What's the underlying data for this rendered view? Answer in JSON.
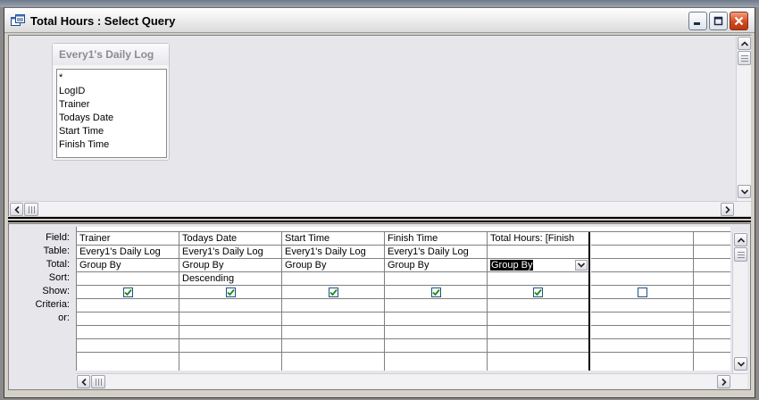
{
  "window": {
    "title": "Total Hours : Select Query",
    "icon": "query-icon",
    "controls": [
      "minimize-icon",
      "maximize-icon",
      "close-icon"
    ]
  },
  "field_list": {
    "title": "Every1's Daily Log",
    "items": [
      "*",
      "LogID",
      "Trainer",
      "Todays Date",
      "Start Time",
      "Finish Time"
    ]
  },
  "grid": {
    "row_labels": [
      "Field:",
      "Table:",
      "Total:",
      "Sort:",
      "Show:",
      "Criteria:",
      "or:"
    ],
    "columns": [
      {
        "field": "Trainer",
        "table": "Every1's Daily Log",
        "total": "Group By",
        "sort": "",
        "show": true
      },
      {
        "field": "Todays Date",
        "table": "Every1's Daily Log",
        "total": "Group By",
        "sort": "Descending",
        "show": true
      },
      {
        "field": "Start Time",
        "table": "Every1's Daily Log",
        "total": "Group By",
        "sort": "",
        "show": true
      },
      {
        "field": "Finish Time",
        "table": "Every1's Daily Log",
        "total": "Group By",
        "sort": "",
        "show": true
      },
      {
        "field": "Total Hours: [Finish",
        "table": "",
        "total": "Group By",
        "sort": "",
        "show": true
      },
      {
        "field": "",
        "table": "",
        "total": "",
        "sort": "",
        "show": false
      },
      {
        "field": "",
        "table": "",
        "total": "",
        "sort": "",
        "show": null
      }
    ]
  },
  "colors": {
    "checkmark": "#1a8a1a",
    "window_bg": "#d4d0c8",
    "pane_bg": "#e7e6ea"
  }
}
